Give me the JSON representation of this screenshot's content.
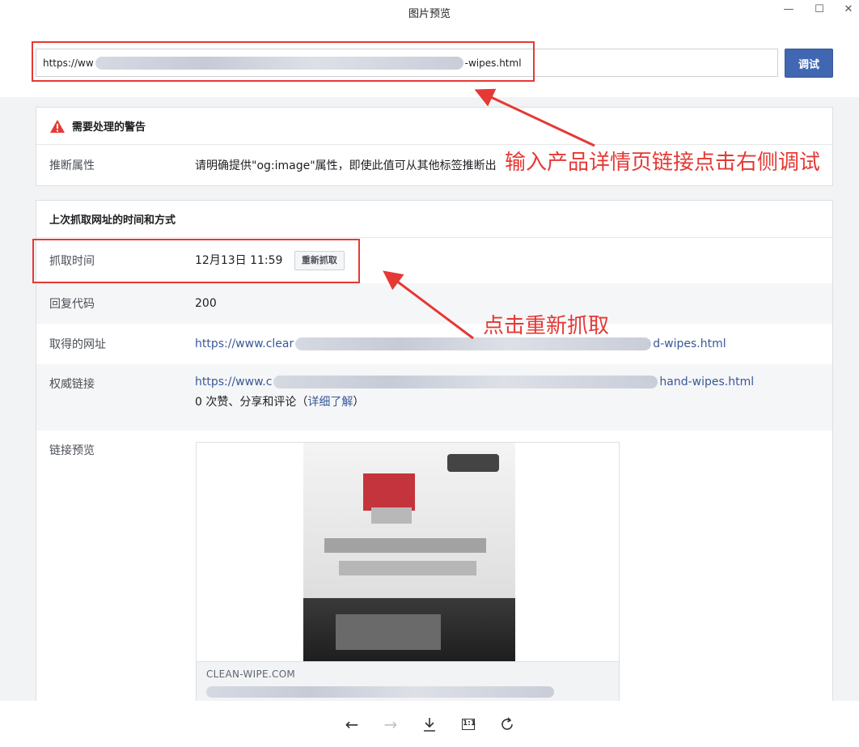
{
  "window": {
    "title": "图片预览",
    "minimize": "—",
    "maximize": "☐",
    "close": "✕"
  },
  "urlbar": {
    "url_prefix": "https://ww",
    "url_suffix": "-wipes.html",
    "debug_label": "调试"
  },
  "warnings": {
    "heading": "需要处理的警告",
    "rows": [
      {
        "label": "推断属性",
        "value": "请明确提供\"og:image\"属性，即使此值可从其他标签推断出"
      }
    ]
  },
  "scrape": {
    "heading": "上次抓取网址的时间和方式",
    "fetch_time_label": "抓取时间",
    "fetch_time_value": "12月13日 11:59",
    "rescrape_label": "重新抓取",
    "response_code_label": "回复代码",
    "response_code_value": "200",
    "fetched_url_label": "取得的网址",
    "fetched_url_prefix": "https://www.clear",
    "fetched_url_suffix": "d-wipes.html",
    "canonical_label": "权威链接",
    "canonical_prefix": "https://www.c",
    "canonical_suffix": "hand-wipes.html",
    "engagement_text": "0 次赞、分享和评论（",
    "learn_more": "详细了解",
    "engagement_close": "）",
    "preview_label": "链接预览",
    "preview_domain": "CLEAN-WIPE.COM"
  },
  "annotations": {
    "debug_hint": "输入产品详情页链接点击右侧调试",
    "rescrape_hint": "点击重新抓取"
  },
  "icons": [
    "warning-icon",
    "back-arrow-icon",
    "forward-arrow-icon",
    "download-icon",
    "actual-size-icon",
    "rotate-icon"
  ],
  "toolbar": {
    "back": "←",
    "forward": "→",
    "actual_size": "1:1"
  },
  "colors": {
    "accent": "#4267b2",
    "link": "#385898",
    "annotation": "#e53935"
  }
}
